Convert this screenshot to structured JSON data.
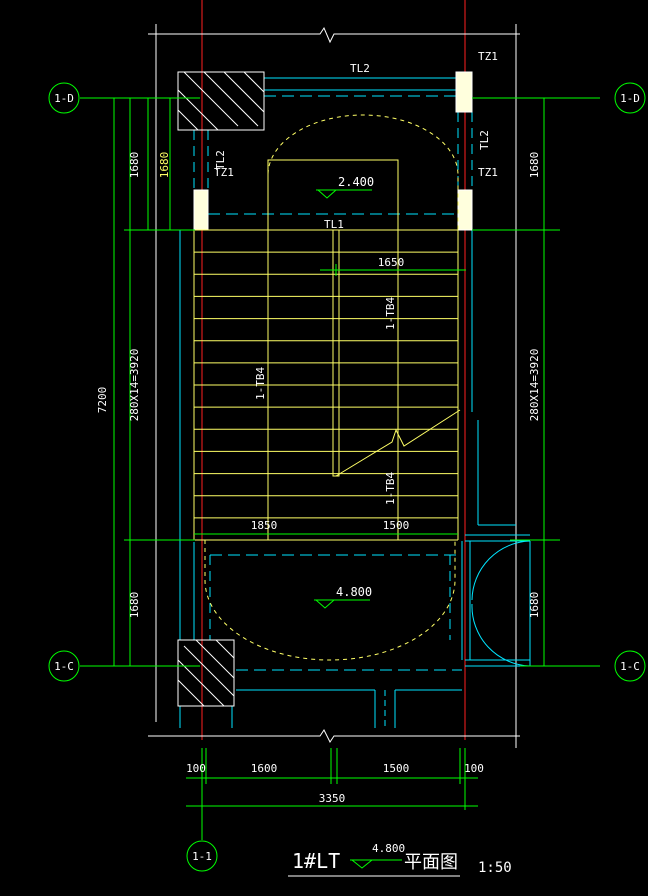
{
  "grid_bubbles": {
    "d_left": "1-D",
    "d_right": "1-D",
    "c_left": "1-C",
    "c_right": "1-C",
    "one_one": "1-1"
  },
  "labels": {
    "tl2_top": "TL2",
    "tz1_top_right": "TZ1",
    "tl2_left_v": "TL2",
    "tz1_left": "TZ1",
    "tl2_right_v": "TL2",
    "tz1_right_mid": "TZ1",
    "tl1": "TL1",
    "tb4_left": "1-TB4",
    "tb4_right_upper": "1-TB4",
    "tb4_right_lower": "1-TB4"
  },
  "elevations": {
    "landing_upper": "2.400",
    "landing_lower": "4.800"
  },
  "dimensions": {
    "left_outer_total": "7200",
    "left_top": "1680",
    "left_top_small": "1680",
    "left_middle": "280X14=3920",
    "left_bottom": "1680",
    "right_top": "1680",
    "right_middle": "280X14=3920",
    "right_bottom": "1680",
    "inner_top_right": "1650",
    "stair_left_width": "1850",
    "stair_right_width": "1500",
    "bottom_left_wall": "100",
    "bottom_left_flight": "1600",
    "bottom_right_flight": "1500",
    "bottom_right_wall": "100",
    "bottom_total": "3350"
  },
  "title": {
    "main": "1#LT",
    "elevation": "4.800",
    "plan": "平面图",
    "scale": "1:50"
  },
  "colors": {
    "background": "#000000",
    "dimension": "#00ff00",
    "wall": "#00e5ff",
    "stair": "#ffff66",
    "axis": "#ff2020",
    "white": "#ffffff"
  }
}
